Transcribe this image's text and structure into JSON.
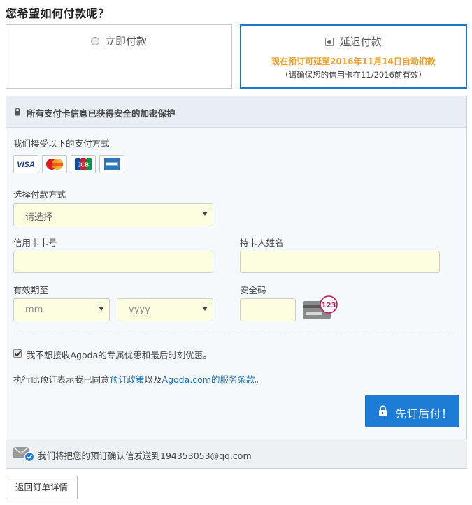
{
  "title": "您希望如何付款呢？",
  "payment_options": {
    "pay_now": {
      "label": "立即付款",
      "selected": false
    },
    "pay_later": {
      "label": "延迟付款",
      "selected": true,
      "note_highlight": "现在预订可延至2016年11月14日自动扣款",
      "note_secondary": "（请确保您的信用卡在11/2016前有效）"
    }
  },
  "panel": {
    "secure_notice": "所有支付卡信息已获得安全的加密保护",
    "accepted_label": "我们接受以下的支付方式",
    "cards": [
      "VISA",
      "MasterCard",
      "JCB",
      "American Express"
    ],
    "method_label": "选择付款方式",
    "method_value": "请选择",
    "card_number_label": "信用卡卡号",
    "card_number_value": "",
    "holder_label": "持卡人姓名",
    "holder_value": "",
    "expiry_label": "有效期至",
    "month_placeholder": "mm",
    "year_placeholder": "yyyy",
    "cvv_label": "安全码",
    "cvv_value": "",
    "cvv_hint": "123",
    "optout_label": "我不想接收Agoda的专属优惠和最后时刻优惠。",
    "optout_checked": true,
    "terms_prefix": "执行此预订表示我已同意",
    "terms_link1": "预订政策",
    "terms_mid": "以及",
    "terms_link2": "Agoda.com的服务条款",
    "terms_suffix": "。",
    "submit_label": "先订后付！",
    "confirm_email_text": "我们将把您的预订确认信发送到194353053@qq.com"
  },
  "back_button": "返回订单详情",
  "colors": {
    "accent": "#1c7cd6",
    "highlight": "#f3a22d",
    "input_bg": "#fdfde0",
    "link": "#1a73b8"
  }
}
